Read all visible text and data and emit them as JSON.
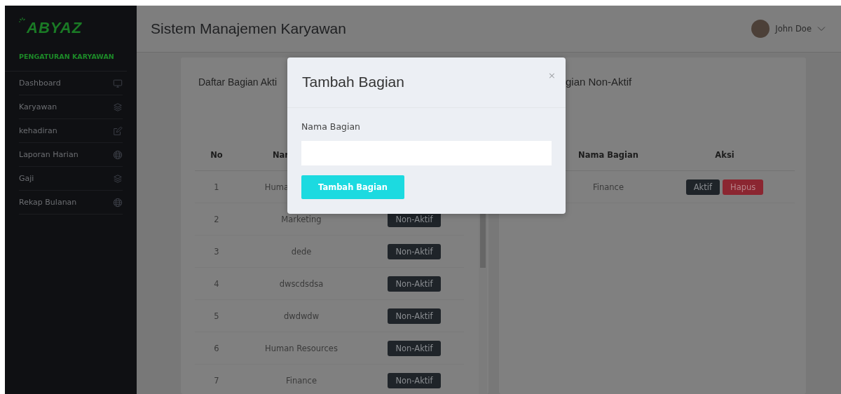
{
  "sidebar": {
    "logo": "ABYAZ",
    "section": "PENGATURAN KARYAWAN",
    "items": [
      {
        "label": "Dashboard",
        "kind": "monitor"
      },
      {
        "label": "Karyawan",
        "kind": "layers"
      },
      {
        "label": "kehadiran",
        "kind": "edit"
      },
      {
        "label": "Laporan Harian",
        "kind": "globe"
      },
      {
        "label": "Gaji",
        "kind": "layers"
      },
      {
        "label": "Rekap Bulanan",
        "kind": "globe"
      }
    ]
  },
  "header": {
    "title": "Sistem Manajemen Karyawan",
    "user": "John Doe"
  },
  "active_card": {
    "title": "Daftar Bagian Akti",
    "columns": [
      "No",
      "Nar"
    ],
    "rows": [
      {
        "no": "1",
        "name": "Huma"
      },
      {
        "no": "2",
        "name": "Marketing",
        "action": "Non-Aktif"
      },
      {
        "no": "3",
        "name": "dede",
        "action": "Non-Aktif"
      },
      {
        "no": "4",
        "name": "dwscdsdsa",
        "action": "Non-Aktif"
      },
      {
        "no": "5",
        "name": "dwdwdw",
        "action": "Non-Aktif"
      },
      {
        "no": "6",
        "name": "Human Resources",
        "action": "Non-Aktif"
      },
      {
        "no": "7",
        "name": "Finance",
        "action": "Non-Aktif"
      }
    ]
  },
  "inactive_card": {
    "title": "gian Non-Aktif",
    "columns": [
      "Nama Bagian",
      "Aksi"
    ],
    "rows": [
      {
        "name": "Finance",
        "actions": [
          {
            "label": "Aktif",
            "kind": "dark"
          },
          {
            "label": "Hapus",
            "kind": "danger"
          }
        ]
      }
    ]
  },
  "modal": {
    "title": "Tambah Bagian",
    "close": "×",
    "field_label": "Nama Bagian",
    "submit": "Tambah Bagian"
  }
}
